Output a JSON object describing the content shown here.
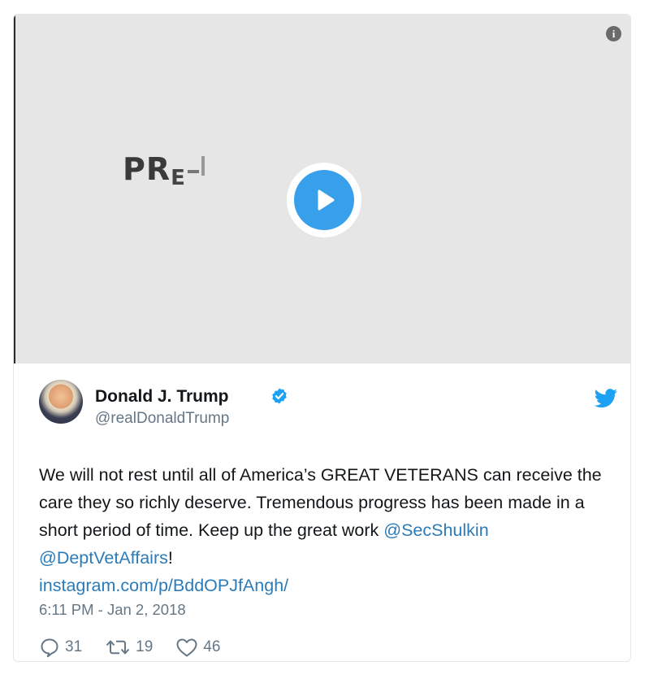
{
  "media": {
    "video_text_big": "PR",
    "video_text_small": "E",
    "info_icon": "info-icon",
    "play_icon": "play-icon"
  },
  "tweet": {
    "author_name": "Donald J. Trump",
    "author_handle": "@realDonaldTrump",
    "verified_icon": "verified-badge-icon",
    "brand_icon": "twitter-bird-icon",
    "text_line": "We will not rest until all of America’s GREAT VETERANS can receive the care they so richly deserve. Tremendous progress has been made in a short period of time. Keep up the great work ",
    "mention_1": "@SecShulkin",
    "mention_2": "@DeptVetAffairs",
    "after_mentions": "!",
    "link": "instagram.com/p/BddOPJfAngh/",
    "timestamp": "6:11 PM - Jan 2, 2018",
    "replies": "31",
    "retweets": "19",
    "likes": "46"
  },
  "colors": {
    "accent": "#1da1f2",
    "link": "#2b7bb9",
    "play_button": "#38a0eb",
    "text": "#14171a",
    "muted": "#657786"
  }
}
